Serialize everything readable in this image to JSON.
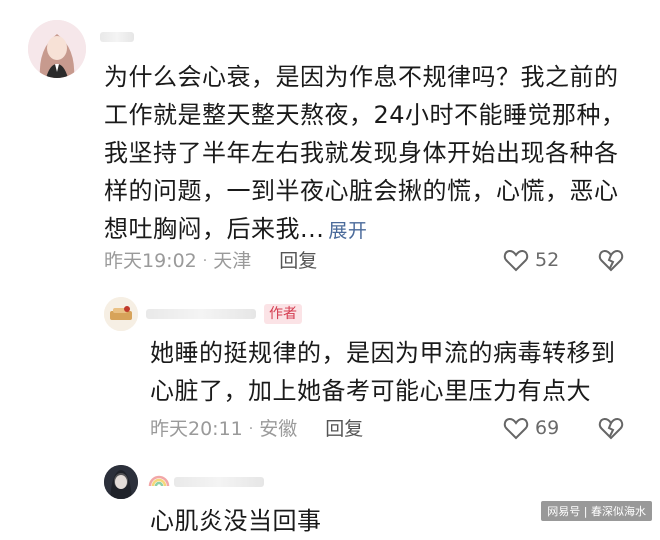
{
  "comments": [
    {
      "text_lines": [
        "为什么会心衰，是因为作息不规律吗？我之前的",
        "工作就是整天整天熬夜，24小时不能睡觉那种，",
        "我坚持了半年左右我就发现身体开始出现各种各",
        "样的问题，一到半夜心脏会揪的慌，心慌，恶心",
        "想吐胸闷，后来我..."
      ],
      "expand_label": "展开",
      "time": "昨天19:02",
      "location": "天津",
      "reply_label": "回复",
      "likes": "52"
    },
    {
      "badge": "作者",
      "text_lines": [
        "她睡的挺规律的，是因为甲流的病毒转移到",
        "心脏了，加上她备考可能心里压力有点大"
      ],
      "time": "昨天20:11",
      "location": "安徽",
      "reply_label": "回复",
      "likes": "69"
    },
    {
      "text_lines": [
        "心肌炎没当回事"
      ]
    }
  ],
  "watermark": "网易号 | 春深似海水",
  "icons": {
    "like": "heart-outline-icon",
    "dislike": "broken-heart-icon",
    "vip": "rainbow-badge-icon"
  }
}
